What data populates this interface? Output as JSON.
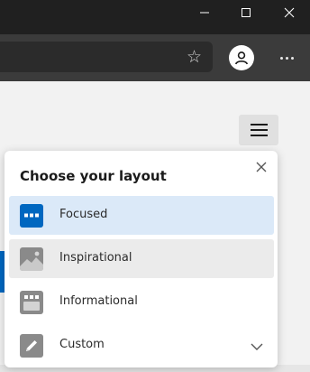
{
  "browser": {
    "window_controls": [
      "minimize-icon",
      "maximize-icon",
      "close-icon"
    ],
    "address_bar": {
      "value": ""
    },
    "toolbar_icons": [
      "favorite-star-icon",
      "profile-icon",
      "more-options-icon"
    ]
  },
  "page": {
    "menu_icon": "hamburger-menu-icon"
  },
  "layout_panel": {
    "title": "Choose your layout",
    "close_icon": "close-icon",
    "options": [
      {
        "label": "Focused",
        "icon": "focused-layout-icon",
        "selected": true
      },
      {
        "label": "Inspirational",
        "icon": "inspirational-layout-icon",
        "selected": false
      },
      {
        "label": "Informational",
        "icon": "informational-layout-icon",
        "selected": false
      },
      {
        "label": "Custom",
        "icon": "pencil-icon",
        "selected": false,
        "expand_icon": "chevron-down-icon"
      }
    ]
  },
  "colors": {
    "titlebar": "#202020",
    "toolbar": "#3b3b3b",
    "accent": "#0067c0",
    "selected_bg": "#dbe9f8",
    "hover_bg": "#ebebeb",
    "icon_gray": "#8a8a8a"
  }
}
